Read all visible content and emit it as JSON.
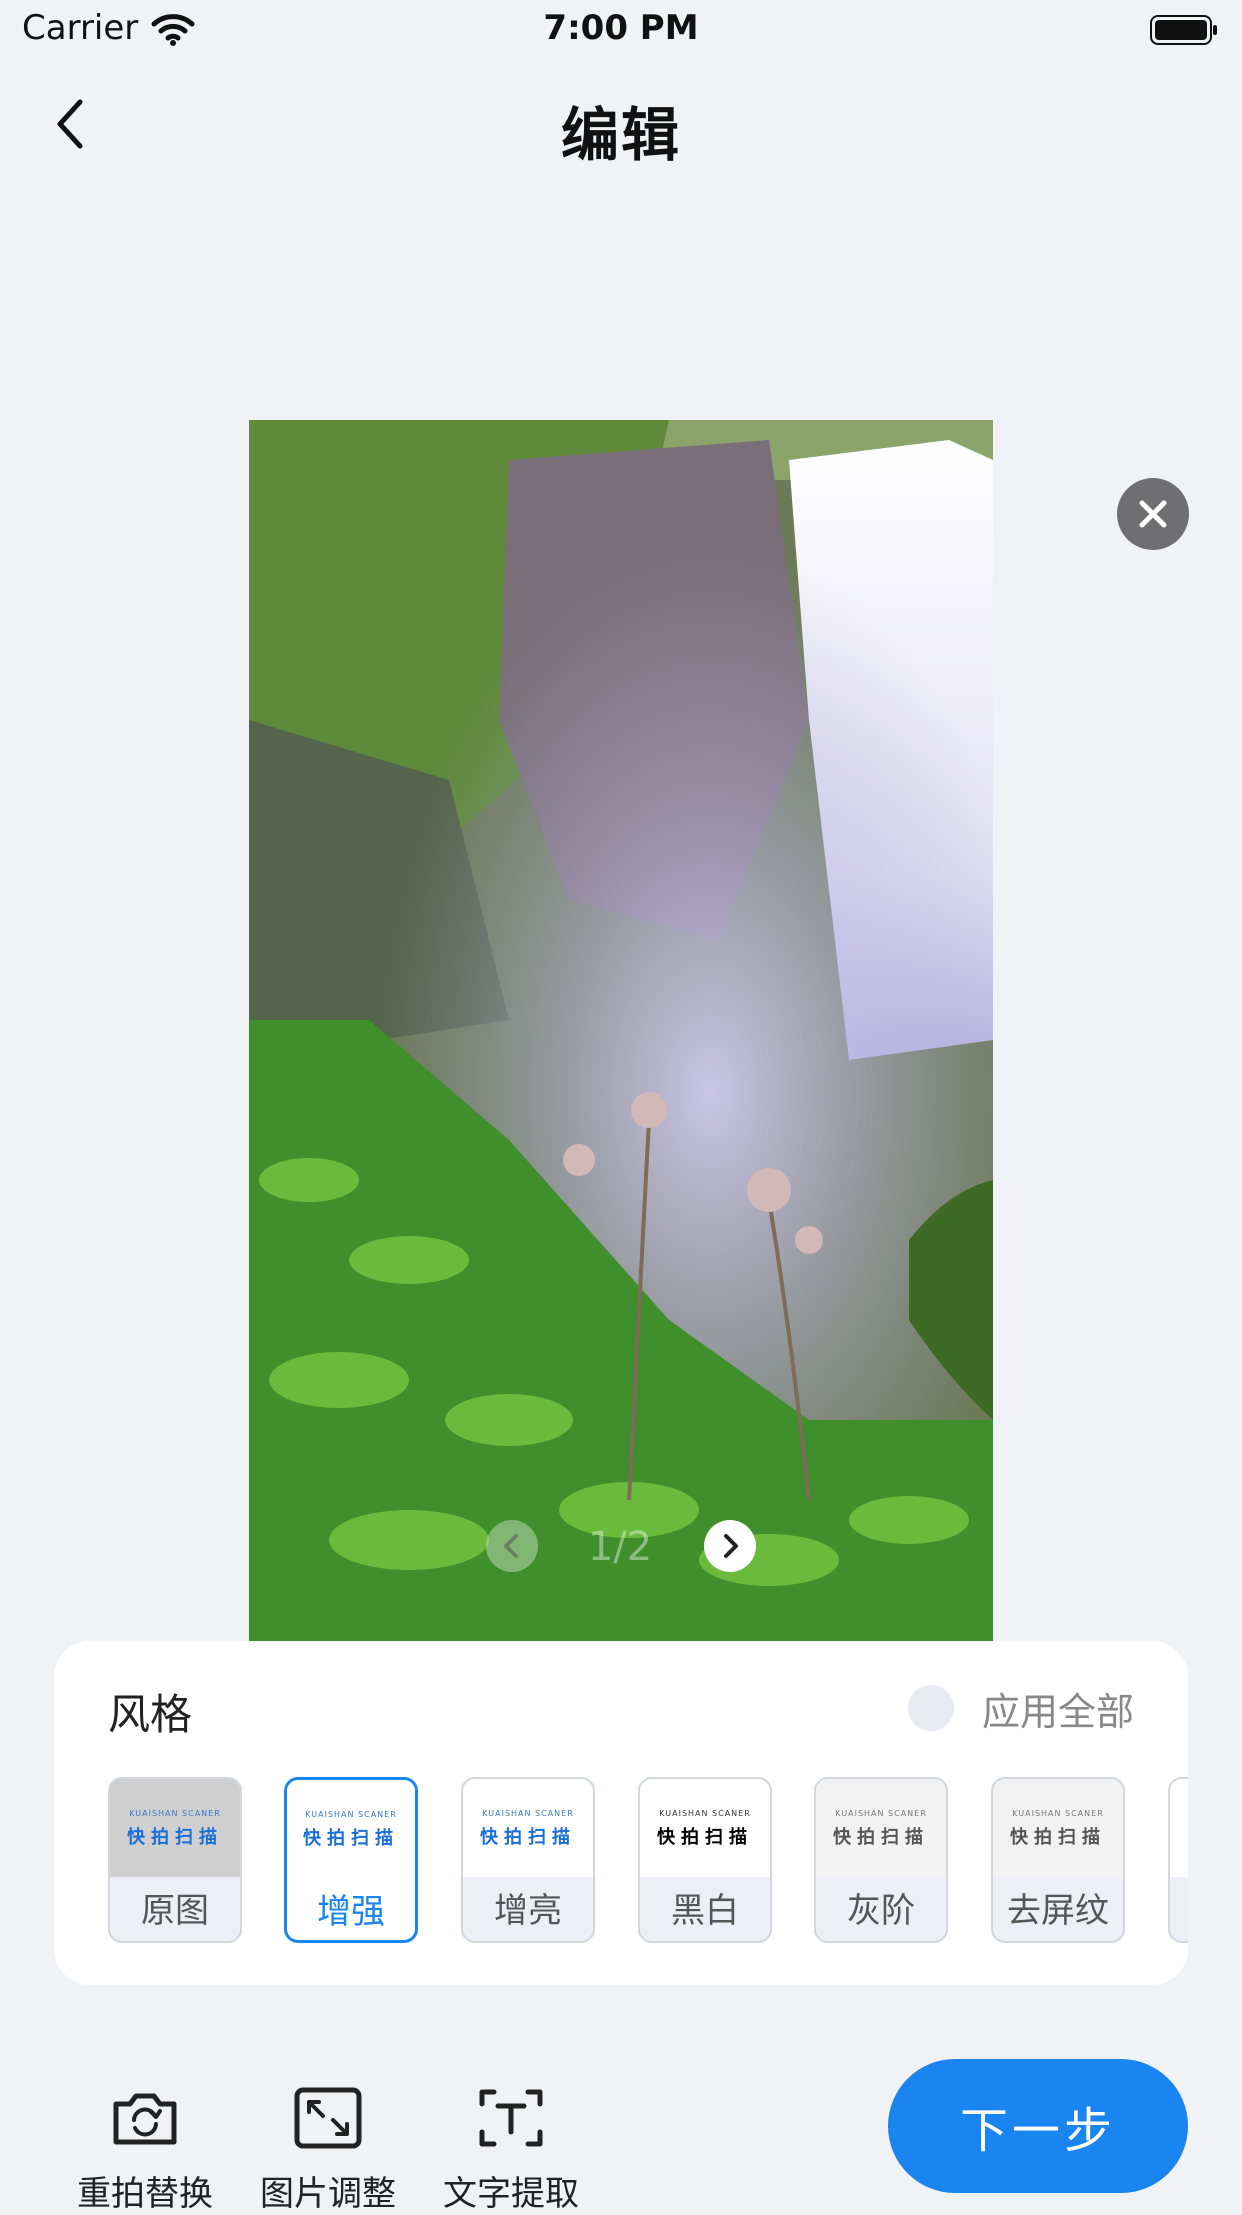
{
  "status_bar": {
    "carrier": "Carrier",
    "time": "7:00 PM"
  },
  "header": {
    "title": "编辑"
  },
  "preview": {
    "page_indicator": "1/2"
  },
  "style_panel": {
    "title": "风格",
    "apply_all_label": "应用全部",
    "filters": [
      {
        "name": "原图",
        "thumb_en": "KUAISHAN SCANER",
        "thumb_cn": "快拍扫描",
        "selected": false
      },
      {
        "name": "增强",
        "thumb_en": "KUAISHAN SCANER",
        "thumb_cn": "快拍扫描",
        "selected": true
      },
      {
        "name": "增亮",
        "thumb_en": "KUAISHAN SCANER",
        "thumb_cn": "快拍扫描",
        "selected": false
      },
      {
        "name": "黑白",
        "thumb_en": "KUAISHAN SCANER",
        "thumb_cn": "快拍扫描",
        "selected": false
      },
      {
        "name": "灰阶",
        "thumb_en": "KUAISHAN SCANER",
        "thumb_cn": "快拍扫描",
        "selected": false
      },
      {
        "name": "去屏纹",
        "thumb_en": "KUAISHAN SCANER",
        "thumb_cn": "快拍扫描",
        "selected": false
      }
    ]
  },
  "toolbar": {
    "retake_label": "重拍替换",
    "adjust_label": "图片调整",
    "ocr_label": "文字提取",
    "next_label": "下一步"
  },
  "colors": {
    "accent": "#1a85f0",
    "background": "#f1f2f6"
  }
}
